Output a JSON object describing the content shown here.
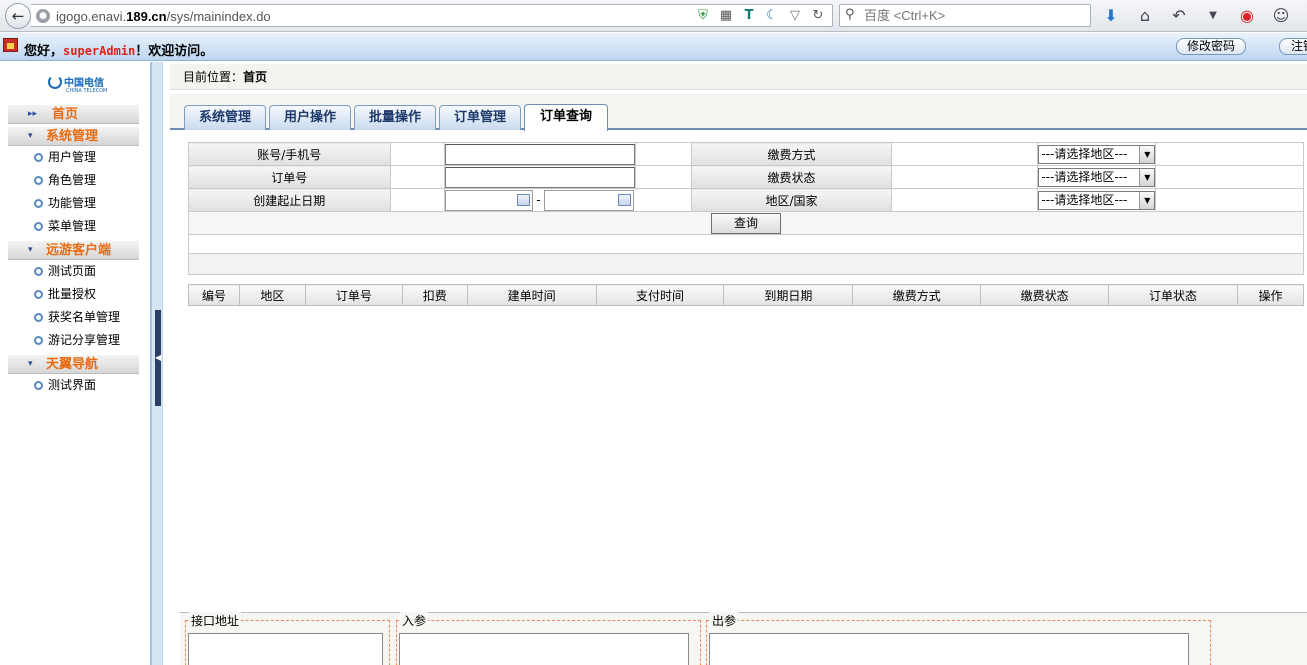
{
  "browser": {
    "url_host": "igogo.enavi.",
    "url_host_bold": "189.cn",
    "url_path": "/sys/mainindex.do",
    "search_placeholder": "百度 <Ctrl+K>"
  },
  "header": {
    "greeting_prefix": "您好，",
    "username": "superAdmin",
    "greeting_suffix": "！欢迎访问。",
    "change_password": "修改密码",
    "logout": "注销"
  },
  "logo": {
    "name": "中国电信",
    "sub": "CHINA TELECOM"
  },
  "sidebar": {
    "groups": [
      {
        "label": "首页",
        "items": []
      },
      {
        "label": "系统管理",
        "items": [
          "用户管理",
          "角色管理",
          "功能管理",
          "菜单管理"
        ]
      },
      {
        "label": "远游客户端",
        "items": [
          "测试页面",
          "批量授权",
          "获奖名单管理",
          "游记分享管理"
        ]
      },
      {
        "label": "天翼导航",
        "items": [
          "测试界面"
        ]
      }
    ]
  },
  "location": {
    "prefix": "目前位置：",
    "current": "首页"
  },
  "tabs": [
    {
      "label": "系统管理",
      "active": false
    },
    {
      "label": "用户操作",
      "active": false
    },
    {
      "label": "批量操作",
      "active": false
    },
    {
      "label": "订单管理",
      "active": false
    },
    {
      "label": "订单查询",
      "active": true
    }
  ],
  "form": {
    "account_label": "账号/手机号",
    "order_no_label": "订单号",
    "date_range_label": "创建起止日期",
    "date_separator": "-",
    "pay_method_label": "缴费方式",
    "pay_status_label": "缴费状态",
    "region_label": "地区/国家",
    "select_placeholder": "---请选择地区---",
    "query_button": "查询"
  },
  "result_table": {
    "columns": [
      "编号",
      "地区",
      "订单号",
      "扣费",
      "建单时间",
      "支付时间",
      "到期日期",
      "缴费方式",
      "缴费状态",
      "订单状态",
      "操作"
    ]
  },
  "bottom": {
    "interface_label": "接口地址",
    "input_label": "入参",
    "output_label": "出参"
  }
}
